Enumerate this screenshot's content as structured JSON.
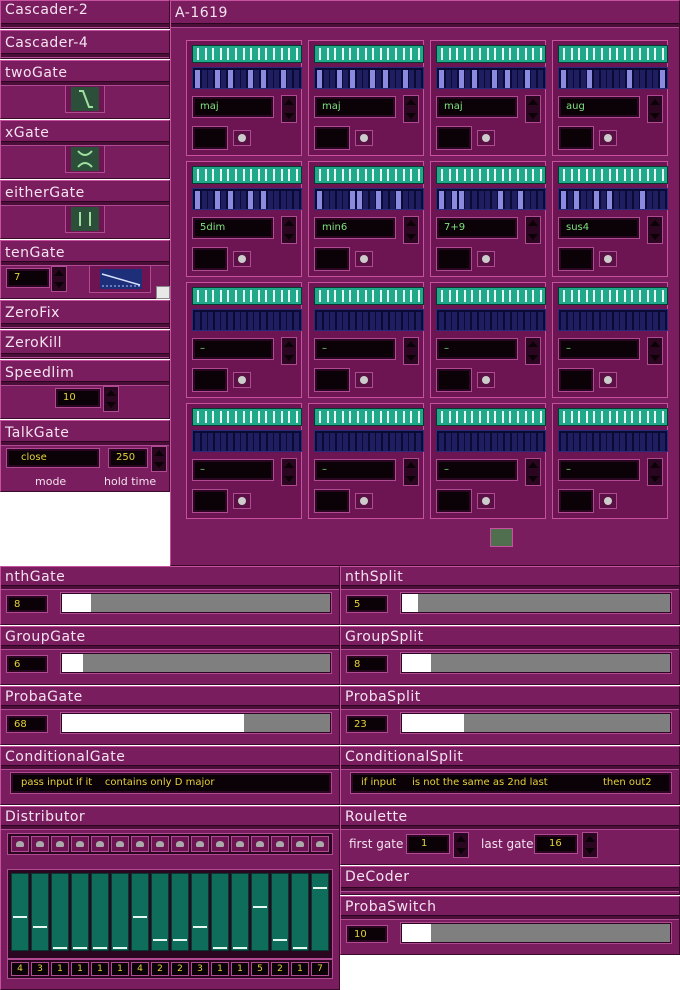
{
  "panels": {
    "cascader2": "Cascader-2",
    "cascader4": "Cascader-4",
    "twogate": "twoGate",
    "xgate": "xGate",
    "eithergate": "eitherGate",
    "tengate": {
      "title": "tenGate",
      "value": "7"
    },
    "zerofix": "ZeroFix",
    "zerokill": "ZeroKill",
    "speedlim": {
      "title": "Speedlim",
      "value": "10"
    },
    "talkgate": {
      "title": "TalkGate",
      "mode": "close",
      "hold": "250",
      "mode_label": "mode",
      "hold_label": "hold time"
    }
  },
  "a1619": {
    "title": "A-1619",
    "chords": [
      "maj",
      "maj",
      "maj",
      "aug",
      "5dim",
      "min6",
      "7+9",
      "sus4",
      "–",
      "–",
      "–",
      "–",
      "–",
      "–",
      "–",
      "–"
    ]
  },
  "bottom": {
    "nthgate": {
      "title": "nthGate",
      "value": "8",
      "level": 0.11
    },
    "nthsplit": {
      "title": "nthSplit",
      "value": "5",
      "level": 0.06
    },
    "groupgate": {
      "title": "GroupGate",
      "value": "6",
      "level": 0.08
    },
    "groupsplit": {
      "title": "GroupSplit",
      "value": "8",
      "level": 0.11
    },
    "probagate": {
      "title": "ProbaGate",
      "value": "68",
      "level": 0.68
    },
    "probasplit": {
      "title": "ProbaSplit",
      "value": "23",
      "level": 0.23
    },
    "conditionalgate": {
      "title": "ConditionalGate",
      "p1": "pass input if it",
      "p2": "contains only D major"
    },
    "conditionalsplit": {
      "title": "ConditionalSplit",
      "p1": "if input",
      "p2": "is not the same as 2nd last",
      "p3": "then out2"
    },
    "distributor": {
      "title": "Distributor",
      "values": [
        "4",
        "3",
        "1",
        "1",
        "1",
        "1",
        "4",
        "2",
        "2",
        "3",
        "1",
        "1",
        "5",
        "2",
        "1",
        "7"
      ]
    },
    "roulette": {
      "title": "Roulette",
      "first_label": "first gate",
      "first": "1",
      "last_label": "last gate",
      "last": "16"
    },
    "decoder": "DeCoder",
    "probaswitch": {
      "title": "ProbaSwitch",
      "value": "10",
      "level": 0.11
    }
  }
}
